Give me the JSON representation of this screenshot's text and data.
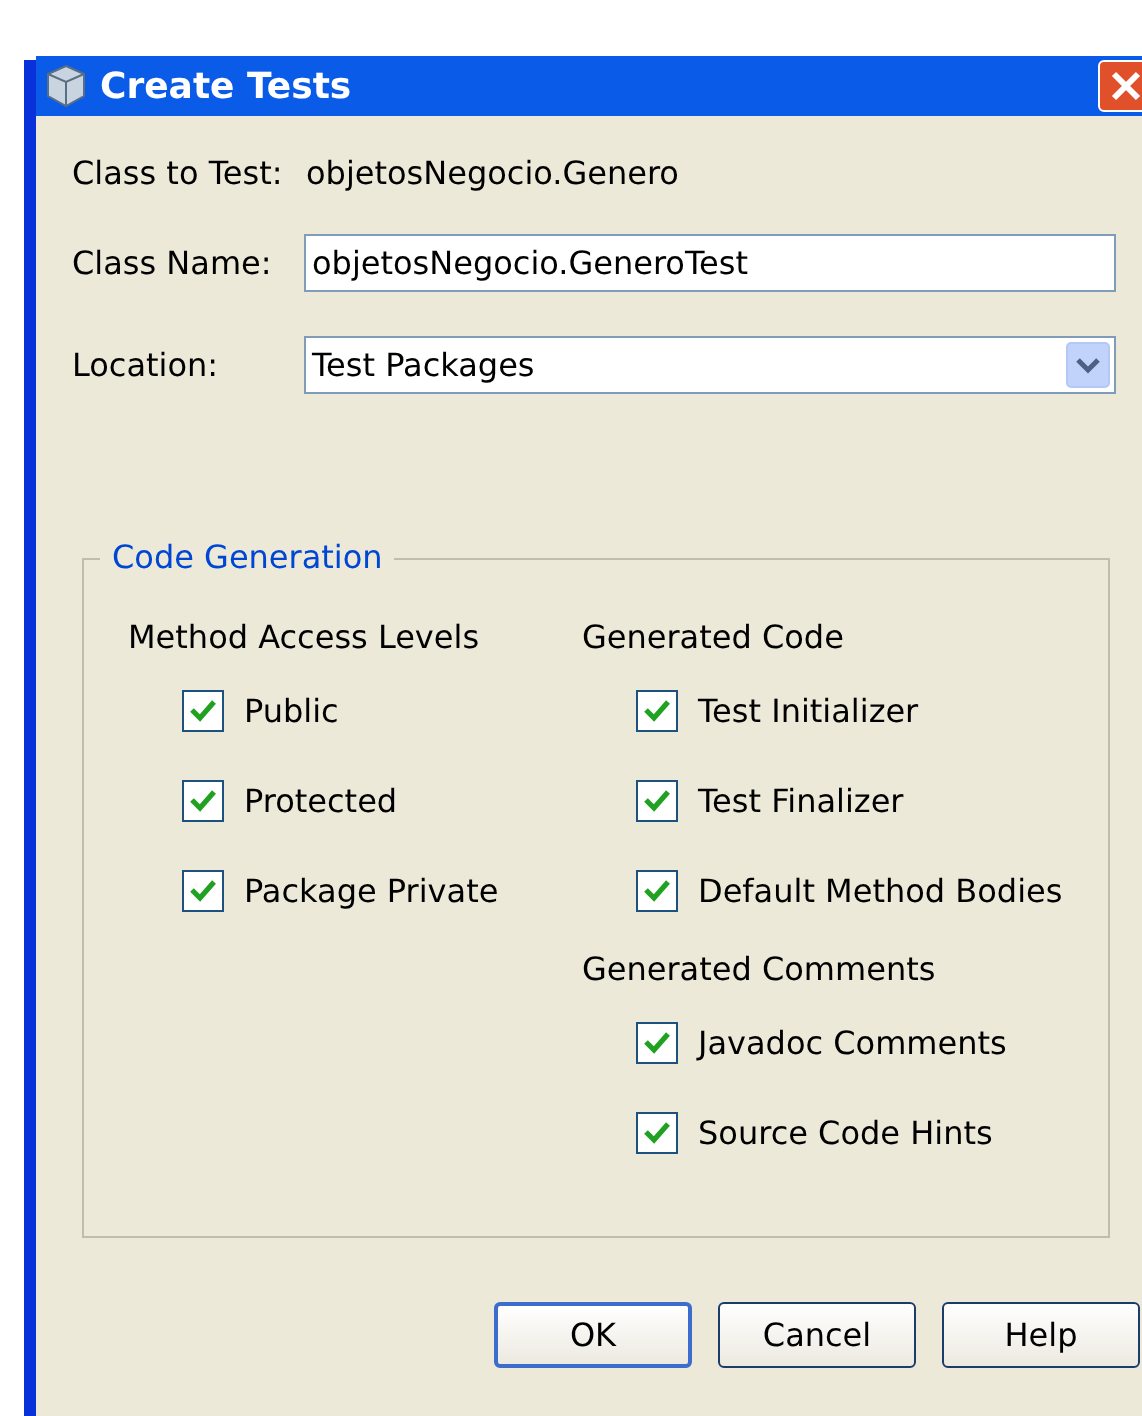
{
  "window": {
    "title": "Create Tests"
  },
  "class_to_test": {
    "label": "Class to Test:",
    "value": "objetosNegocio.Genero"
  },
  "class_name": {
    "label": "Class Name:",
    "value": "objetosNegocio.GeneroTest"
  },
  "location": {
    "label": "Location:",
    "value": "Test Packages"
  },
  "code_generation": {
    "title": "Code Generation",
    "columns": [
      [
        {
          "heading": "Method Access Levels",
          "options": [
            {
              "label": "Public",
              "checked": true
            },
            {
              "label": "Protected",
              "checked": true
            },
            {
              "label": "Package Private",
              "checked": true
            }
          ]
        }
      ],
      [
        {
          "heading": "Generated Code",
          "options": [
            {
              "label": "Test Initializer",
              "checked": true
            },
            {
              "label": "Test Finalizer",
              "checked": true
            },
            {
              "label": "Default Method Bodies",
              "checked": true
            }
          ]
        },
        {
          "heading": "Generated Comments",
          "options": [
            {
              "label": "Javadoc Comments",
              "checked": true
            },
            {
              "label": "Source Code Hints",
              "checked": true
            }
          ]
        }
      ]
    ]
  },
  "buttons": [
    {
      "label": "OK",
      "default": true
    },
    {
      "label": "Cancel",
      "default": false
    },
    {
      "label": "Help",
      "default": false
    }
  ]
}
